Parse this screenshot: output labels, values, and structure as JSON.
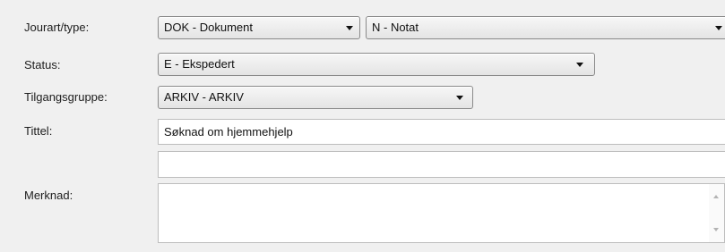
{
  "labels": {
    "journal_type": "Jourart/type:",
    "status": "Status:",
    "access_group": "Tilgangsgruppe:",
    "title": "Tittel:",
    "remark": "Merknad:"
  },
  "journal_type_select": {
    "value": "DOK - Dokument",
    "icon": "chevron-down-icon"
  },
  "note_type_select": {
    "value": "N - Notat",
    "icon": "chevron-down-icon"
  },
  "status_select": {
    "value": "E - Ekspedert",
    "icon": "chevron-down-icon"
  },
  "access_group_select": {
    "value": "ARKIV - ARKIV",
    "icon": "chevron-down-icon"
  },
  "title_input": {
    "value": "Søknad om hjemmehjelp"
  },
  "secondary_title_input": {
    "value": ""
  },
  "remark_textarea": {
    "value": "",
    "scroll_icons": [
      "scroll-up-icon",
      "scroll-down-icon"
    ]
  }
}
